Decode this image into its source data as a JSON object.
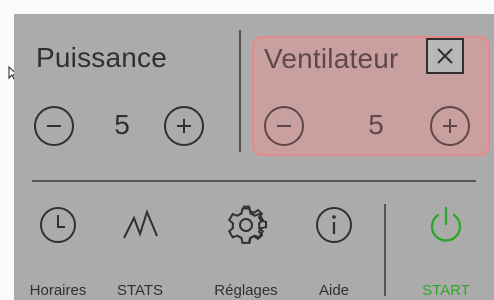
{
  "puissance": {
    "title": "Puissance",
    "value": "5"
  },
  "ventilateur": {
    "title": "Ventilateur",
    "value": "5"
  },
  "nav": {
    "horaires": "Horaires",
    "stats": "STATS",
    "reglages": "Réglages",
    "aide": "Aide",
    "start": "START"
  },
  "icons": {
    "minus": "minus-icon",
    "plus": "plus-icon",
    "close": "close-icon",
    "clock": "clock-icon",
    "stats": "stats-icon",
    "gear": "gear-icon",
    "info": "info-icon",
    "power": "power-icon"
  },
  "colors": {
    "panel": "#ababab",
    "highlight": "#e58a8a",
    "text": "#303030",
    "start": "#2fa62f"
  }
}
